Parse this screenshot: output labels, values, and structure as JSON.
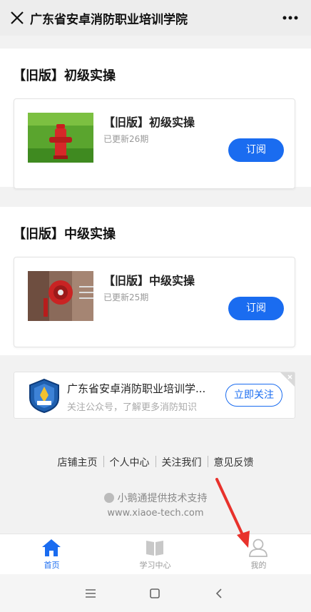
{
  "titlebar": {
    "title": "广东省安卓消防职业培训学院"
  },
  "sections": [
    {
      "heading": "【旧版】初级实操",
      "card_title": "【旧版】初级实操",
      "card_sub": "已更新26期",
      "button": "订阅"
    },
    {
      "heading": "【旧版】中级实操",
      "card_title": "【旧版】中级实操",
      "card_sub": "已更新25期",
      "button": "订阅"
    }
  ],
  "follow": {
    "title": "广东省安卓消防职业培训学...",
    "subtitle": "关注公众号，了解更多消防知识",
    "button": "立即关注"
  },
  "footer": {
    "links": [
      "店铺主页",
      "个人中心",
      "关注我们",
      "意见反馈"
    ],
    "powered": "小鹅通提供技术支持",
    "site": "www.xiaoe-tech.com"
  },
  "tabbar": [
    {
      "label": "首页",
      "icon": "home-icon",
      "active": true
    },
    {
      "label": "学习中心",
      "icon": "book-icon",
      "active": false
    },
    {
      "label": "我的",
      "icon": "user-icon",
      "active": false
    }
  ],
  "colors": {
    "accent": "#1a6cf0",
    "annotation_arrow": "#e8322c"
  }
}
